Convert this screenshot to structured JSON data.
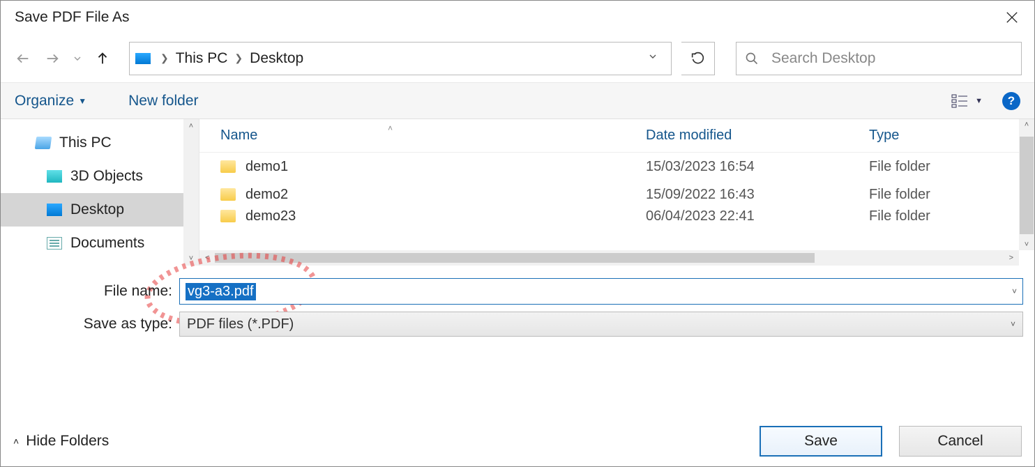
{
  "dialog": {
    "title": "Save PDF File As"
  },
  "breadcrumb": {
    "root": "This PC",
    "folder": "Desktop"
  },
  "search": {
    "placeholder": "Search Desktop"
  },
  "toolbar": {
    "organize": "Organize",
    "newfolder": "New folder"
  },
  "sidebar": {
    "items": [
      {
        "label": "This PC"
      },
      {
        "label": "3D Objects"
      },
      {
        "label": "Desktop"
      },
      {
        "label": "Documents"
      }
    ]
  },
  "columns": {
    "name": "Name",
    "date": "Date modified",
    "type": "Type"
  },
  "files": [
    {
      "name": "demo1",
      "date": "15/03/2023 16:54",
      "type": "File folder"
    },
    {
      "name": "demo2",
      "date": "15/09/2022 16:43",
      "type": "File folder"
    },
    {
      "name": "demo23",
      "date": "06/04/2023 22:41",
      "type": "File folder"
    }
  ],
  "form": {
    "filename_label": "File name:",
    "filename_value": "vg3-a3.pdf",
    "type_label": "Save as type:",
    "type_value": "PDF files (*.PDF)"
  },
  "bottom": {
    "hide_folders": "Hide Folders",
    "save": "Save",
    "cancel": "Cancel"
  },
  "help": "?"
}
